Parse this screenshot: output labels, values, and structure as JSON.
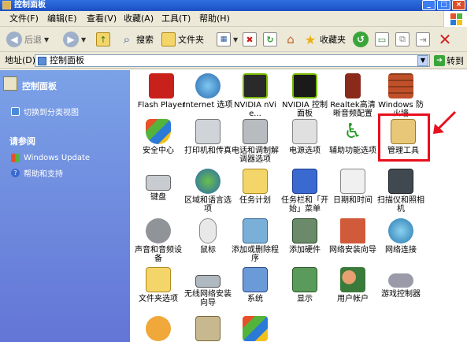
{
  "window": {
    "title": "控制面板"
  },
  "menu": [
    "文件(F)",
    "编辑(E)",
    "查看(V)",
    "收藏(A)",
    "工具(T)",
    "帮助(H)"
  ],
  "toolbar": {
    "back": "后退",
    "search": "搜索",
    "folders": "文件夹"
  },
  "address": {
    "label": "地址(D)",
    "value": "控制面板",
    "go": "转到"
  },
  "sidebar": {
    "panel1_title": "控制面板",
    "switch_view": "切换到分类视图",
    "panel2_title": "请参阅",
    "windows_update": "Windows Update",
    "help": "帮助和支持"
  },
  "items": [
    "Flash Player",
    "Internet 选项",
    "NVIDIA nVie...",
    "NVIDIA 控制面板",
    "Realtek高清晰音频配置",
    "Windows 防火墙",
    "安全中心",
    "打印机和传真",
    "电话和调制解调器选项",
    "电源选项",
    "辅助功能选项",
    "管理工具",
    "键盘",
    "区域和语言选项",
    "任务计划",
    "任务栏和「开始」菜单",
    "日期和时间",
    "扫描仪和照相机",
    "声音和音频设备",
    "鼠标",
    "添加或删除程序",
    "添加硬件",
    "网络安装向导",
    "网络连接",
    "文件夹选项",
    "无线网络安装向导",
    "系统",
    "显示",
    "用户帐户",
    "游戏控制器"
  ],
  "colors": {
    "highlight": "#e8101e",
    "titlebar": "#2f6fe0",
    "sidebar": "#7ba2e7"
  }
}
